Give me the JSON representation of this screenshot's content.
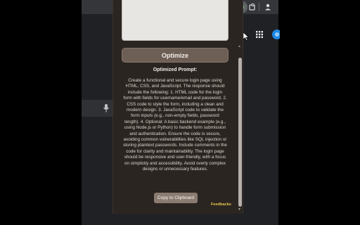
{
  "toolbar": {
    "icons": [
      "star-icon",
      "extension-active-icon",
      "puzzle-icon",
      "profile-icon"
    ],
    "accent": "#2e7d32"
  },
  "popup": {
    "optimize_label": "Optimize",
    "result_title": "Optimized Prompt:",
    "result_text": "Create a functional and secure login page using HTML, CSS, and JavaScript. The response should include the following: 1. HTML code for the login form with fields for username/email and password. 2. CSS code to style the form, including a clean and modern design. 3. JavaScript code to validate the form inputs (e.g., non-empty fields, password length). 4. Optional: A basic backend example (e.g., using Node.js or Python) to handle form submission and authentication. Ensure the code is secure, avoiding common vulnerabilities like SQL injection or storing plaintext passwords. Include comments in the code for clarity and maintainability. The login page should be responsive and user-friendly, with a focus on simplicity and accessibility. Avoid overly complex designs or unnecessary features.",
    "copy_label": "Copy to Clipboard",
    "feedback_label": "Feedbacks",
    "colors": {
      "background": "#2b2521",
      "button": "#6d5f55",
      "feedback": "#e8c84a"
    }
  }
}
